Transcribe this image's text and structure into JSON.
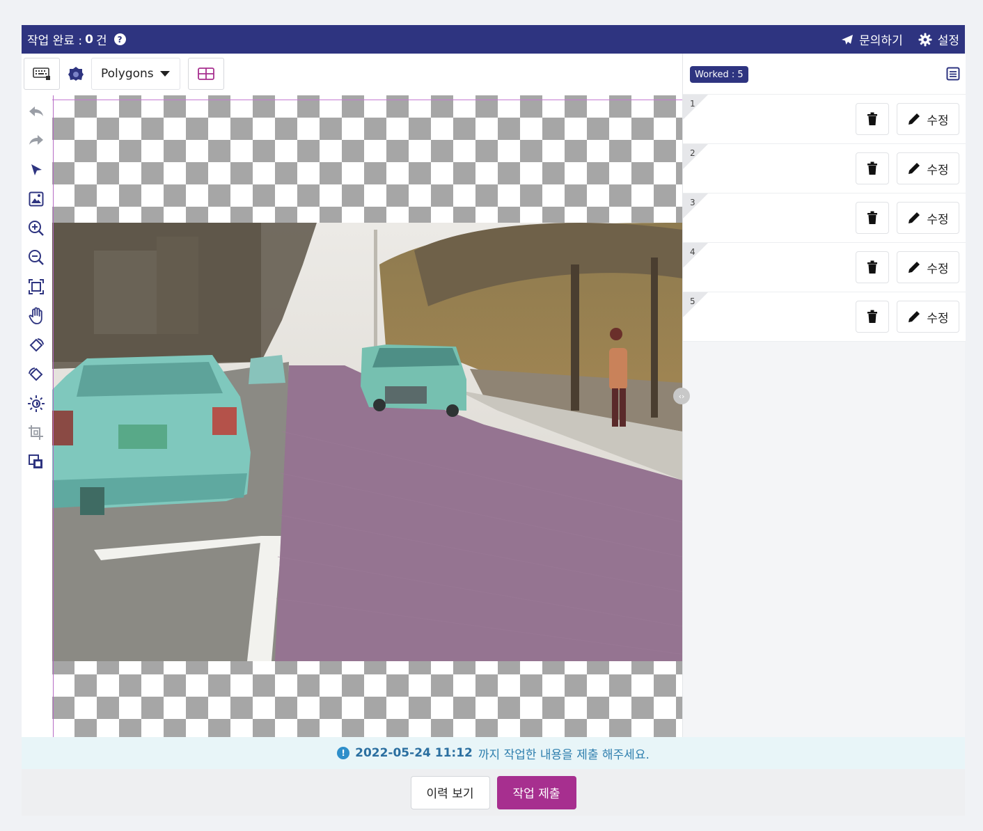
{
  "topbar": {
    "status_label": "작업 완료 : ",
    "status_count": "0",
    "status_unit": "건",
    "help_icon": "?",
    "inquiry_label": "문의하기",
    "settings_label": "설정",
    "bg_color": "#2e3480"
  },
  "toolbar": {
    "shape_mode": "Polygons",
    "icons": [
      "keyboard-icon",
      "polygon-gear-icon",
      "caret-down-icon",
      "grid-split-icon"
    ]
  },
  "left_tools": [
    "undo-icon",
    "redo-icon",
    "select-arrow-icon",
    "image-icon",
    "zoom-in-icon",
    "zoom-out-icon",
    "fit-screen-icon",
    "pan-hand-icon",
    "rotate-left-icon",
    "rotate-right-icon",
    "brightness-icon",
    "crop-icon",
    "layers-icon"
  ],
  "right_panel": {
    "worked_badge": "Worked : 5",
    "rows": [
      {
        "index": "1",
        "edit_label": "수정"
      },
      {
        "index": "2",
        "edit_label": "수정"
      },
      {
        "index": "3",
        "edit_label": "수정"
      },
      {
        "index": "4",
        "edit_label": "수정"
      },
      {
        "index": "5",
        "edit_label": "수정"
      }
    ]
  },
  "footer": {
    "deadline_date": "2022-05-24 11:12",
    "deadline_text": "까지 작업한 내용을 제출 해주세요.",
    "history_button": "이력 보기",
    "submit_button": "작업 제출",
    "submit_color": "#a72f8f"
  }
}
